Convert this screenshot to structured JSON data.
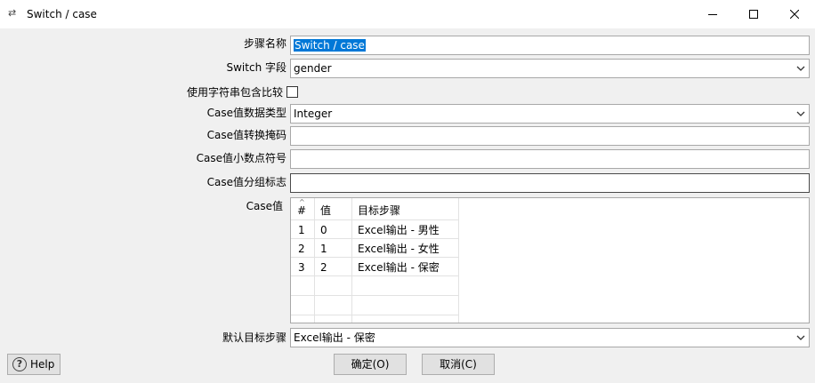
{
  "window": {
    "title": "Switch / case",
    "icon": "transform-arrows-icon"
  },
  "form": {
    "step_name_label": "步骤名称",
    "step_name_value": "Switch / case",
    "switch_field_label": "Switch 字段",
    "switch_field_value": "gender",
    "use_contains_label": "使用字符串包含比较",
    "use_contains_checked": false,
    "case_type_label": "Case值数据类型",
    "case_type_value": "Integer",
    "case_mask_label": "Case值转换掩码",
    "case_mask_value": "",
    "case_decimal_label": "Case值小数点符号",
    "case_decimal_value": "",
    "case_group_label": "Case值分组标志",
    "case_group_value": "",
    "case_values_label": "Case值",
    "default_target_label": "默认目标步骤",
    "default_target_value": "Excel输出 - 保密"
  },
  "table": {
    "headers": [
      "#",
      "值",
      "目标步骤"
    ],
    "rows": [
      [
        "1",
        "0",
        "Excel输出 - 男性"
      ],
      [
        "2",
        "1",
        "Excel输出 - 女性"
      ],
      [
        "3",
        "2",
        "Excel输出 - 保密"
      ]
    ]
  },
  "buttons": {
    "help": "Help",
    "ok": "确定(O)",
    "cancel": "取消(C)"
  }
}
